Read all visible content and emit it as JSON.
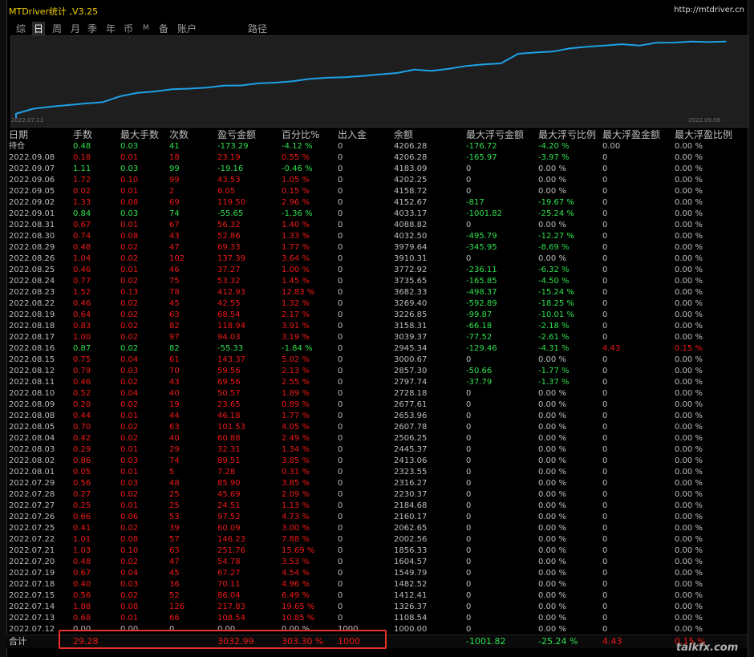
{
  "app": {
    "title": "MTDriver统计 ,V3.25",
    "url": "http://mtdriver.cn"
  },
  "tabs": [
    {
      "label": "综"
    },
    {
      "label": "日"
    },
    {
      "label": "周"
    },
    {
      "label": "月"
    },
    {
      "label": "季"
    },
    {
      "label": "年"
    },
    {
      "label": "币"
    },
    {
      "label": "M"
    },
    {
      "label": "备"
    },
    {
      "label": "账户"
    },
    {
      "label": "路径"
    }
  ],
  "chart": {
    "start_date": "2022.07.13",
    "end_date": "2022.09.08",
    "line_color": "#1ea1e6",
    "background": "#1e1e1e"
  },
  "chart_data": {
    "type": "line",
    "x": [
      "2022.07.13",
      "2022.07.14",
      "2022.07.15",
      "2022.07.18",
      "2022.07.19",
      "2022.07.20",
      "2022.07.21",
      "2022.07.22",
      "2022.07.25",
      "2022.07.26",
      "2022.07.27",
      "2022.07.28",
      "2022.07.29",
      "2022.08.01",
      "2022.08.02",
      "2022.08.03",
      "2022.08.04",
      "2022.08.05",
      "2022.08.08",
      "2022.08.09",
      "2022.08.10",
      "2022.08.11",
      "2022.08.12",
      "2022.08.15",
      "2022.08.16",
      "2022.08.17",
      "2022.08.18",
      "2022.08.19",
      "2022.08.22",
      "2022.08.23",
      "2022.08.24",
      "2022.08.25",
      "2022.08.26",
      "2022.08.29",
      "2022.08.30",
      "2022.08.31",
      "2022.09.01",
      "2022.09.02",
      "2022.09.05",
      "2022.09.06",
      "2022.09.07",
      "2022.09.08"
    ],
    "y": [
      1108.54,
      1326.37,
      1412.41,
      1482.52,
      1549.79,
      1604.57,
      1856.33,
      2002.56,
      2062.65,
      2160.17,
      2184.68,
      2230.37,
      2316.27,
      2323.55,
      2413.06,
      2445.37,
      2506.25,
      2607.78,
      2653.96,
      2677.61,
      2728.18,
      2797.74,
      2857.3,
      3000.67,
      2945.34,
      3039.37,
      3158.31,
      3226.85,
      3269.4,
      3682.33,
      3735.65,
      3772.92,
      3910.31,
      3979.64,
      4032.5,
      4088.82,
      4033.17,
      4152.67,
      4158.72,
      4202.25,
      4183.09,
      4206.28
    ],
    "ylim": [
      1000,
      4300
    ],
    "grid": false
  },
  "table": {
    "headers": [
      "日期",
      "手数",
      "最大手数",
      "次数",
      "盈亏金额",
      "百分比%",
      "出入金",
      "余额",
      "最大浮亏金额",
      "最大浮亏比例",
      "最大浮盈金额",
      "最大浮盈比例"
    ],
    "rows": [
      {
        "cells": [
          "持仓",
          "0.48",
          "0.03",
          "41",
          "-173.29",
          "-4.12 %",
          "0",
          "4206.28",
          "-176.72",
          "-4.20 %",
          "0.00",
          "0.00 %"
        ],
        "t": "pos",
        "v": "neg"
      },
      {
        "cells": [
          "2022.09.08",
          "0.18",
          "0.01",
          "18",
          "23.19",
          "0.55 %",
          "0",
          "4206.28",
          "-165.97",
          "-3.97 %",
          "0",
          "0.00 %"
        ],
        "t": "neg",
        "v": "neg"
      },
      {
        "cells": [
          "2022.09.07",
          "1.11",
          "0.03",
          "99",
          "-19.16",
          "-0.46 %",
          "0",
          "4183.09",
          "0",
          "0.00 %",
          "0",
          "0.00 %"
        ],
        "t": "pos",
        "v": "zero"
      },
      {
        "cells": [
          "2022.09.06",
          "1.72",
          "0.10",
          "99",
          "43.53",
          "1.05 %",
          "0",
          "4202.25",
          "0",
          "0.00 %",
          "0",
          "0.00 %"
        ],
        "t": "neg",
        "v": "zero"
      },
      {
        "cells": [
          "2022.09.05",
          "0.02",
          "0.01",
          "2",
          "6.05",
          "0.15 %",
          "0",
          "4158.72",
          "0",
          "0.00 %",
          "0",
          "0.00 %"
        ],
        "t": "neg",
        "v": "zero"
      },
      {
        "cells": [
          "2022.09.02",
          "1.33",
          "0.08",
          "69",
          "119.50",
          "2.96 %",
          "0",
          "4152.67",
          "-817",
          "-19.67 %",
          "0",
          "0.00 %"
        ],
        "t": "neg",
        "v": "neg"
      },
      {
        "cells": [
          "2022.09.01",
          "0.84",
          "0.03",
          "74",
          "-55.65",
          "-1.36 %",
          "0",
          "4033.17",
          "-1001.82",
          "-25.24 %",
          "0",
          "0.00 %"
        ],
        "t": "pos",
        "v": "neg"
      },
      {
        "cells": [
          "2022.08.31",
          "0.67",
          "0.01",
          "67",
          "56.32",
          "1.40 %",
          "0",
          "4088.82",
          "0",
          "0.00 %",
          "0",
          "0.00 %"
        ],
        "t": "neg",
        "v": "zero"
      },
      {
        "cells": [
          "2022.08.30",
          "0.74",
          "0.08",
          "43",
          "52.86",
          "1.33 %",
          "0",
          "4032.50",
          "-495.79",
          "-12.27 %",
          "0",
          "0.00 %"
        ],
        "t": "neg",
        "v": "neg"
      },
      {
        "cells": [
          "2022.08.29",
          "0.48",
          "0.02",
          "47",
          "69.33",
          "1.77 %",
          "0",
          "3979.64",
          "-345.95",
          "-8.69 %",
          "0",
          "0.00 %"
        ],
        "t": "neg",
        "v": "neg"
      },
      {
        "cells": [
          "2022.08.26",
          "1.04",
          "0.02",
          "102",
          "137.39",
          "3.64 %",
          "0",
          "3910.31",
          "0",
          "0.00 %",
          "0",
          "0.00 %"
        ],
        "t": "neg",
        "v": "zero"
      },
      {
        "cells": [
          "2022.08.25",
          "0.46",
          "0.01",
          "46",
          "37.27",
          "1.00 %",
          "0",
          "3772.92",
          "-236.11",
          "-6.32 %",
          "0",
          "0.00 %"
        ],
        "t": "neg",
        "v": "neg"
      },
      {
        "cells": [
          "2022.08.24",
          "0.77",
          "0.02",
          "75",
          "53.32",
          "1.45 %",
          "0",
          "3735.65",
          "-165.85",
          "-4.50 %",
          "0",
          "0.00 %"
        ],
        "t": "neg",
        "v": "neg"
      },
      {
        "cells": [
          "2022.08.23",
          "1.52",
          "0.13",
          "78",
          "412.93",
          "12.83 %",
          "0",
          "3682.33",
          "-498.37",
          "-15.24 %",
          "0",
          "0.00 %"
        ],
        "t": "neg",
        "v": "neg"
      },
      {
        "cells": [
          "2022.08.22",
          "0.46",
          "0.02",
          "45",
          "42.55",
          "1.32 %",
          "0",
          "3269.40",
          "-592.89",
          "-18.25 %",
          "0",
          "0.00 %"
        ],
        "t": "neg",
        "v": "neg"
      },
      {
        "cells": [
          "2022.08.19",
          "0.64",
          "0.02",
          "63",
          "68.54",
          "2.17 %",
          "0",
          "3226.85",
          "-99.87",
          "-10.01 %",
          "0",
          "0.00 %"
        ],
        "t": "neg",
        "v": "neg"
      },
      {
        "cells": [
          "2022.08.18",
          "0.83",
          "0.02",
          "82",
          "118.94",
          "3.91 %",
          "0",
          "3158.31",
          "-66.18",
          "-2.18 %",
          "0",
          "0.00 %"
        ],
        "t": "neg",
        "v": "neg"
      },
      {
        "cells": [
          "2022.08.17",
          "1.00",
          "0.02",
          "97",
          "94.03",
          "3.19 %",
          "0",
          "3039.37",
          "-77.52",
          "-2.61 %",
          "0",
          "0.00 %"
        ],
        "t": "neg",
        "v": "neg"
      },
      {
        "cells": [
          "2022.08.16",
          "0.87",
          "0.02",
          "82",
          "-55.33",
          "-1.84 %",
          "0",
          "2945.34",
          "-129.46",
          "-4.31 %",
          "4.43",
          "0.15 %"
        ],
        "t": "pos",
        "v": "both"
      },
      {
        "cells": [
          "2022.08.15",
          "0.75",
          "0.04",
          "61",
          "143.37",
          "5.02 %",
          "0",
          "3000.67",
          "0",
          "0.00 %",
          "0",
          "0.00 %"
        ],
        "t": "neg",
        "v": "zero"
      },
      {
        "cells": [
          "2022.08.12",
          "0.79",
          "0.03",
          "70",
          "59.56",
          "2.13 %",
          "0",
          "2857.30",
          "-50.66",
          "-1.77 %",
          "0",
          "0.00 %"
        ],
        "t": "neg",
        "v": "neg"
      },
      {
        "cells": [
          "2022.08.11",
          "0.46",
          "0.02",
          "43",
          "69.56",
          "2.55 %",
          "0",
          "2797.74",
          "-37.79",
          "-1.37 %",
          "0",
          "0.00 %"
        ],
        "t": "neg",
        "v": "neg"
      },
      {
        "cells": [
          "2022.08.10",
          "0.52",
          "0.04",
          "40",
          "50.57",
          "1.89 %",
          "0",
          "2728.18",
          "0",
          "0.00 %",
          "0",
          "0.00 %"
        ],
        "t": "neg",
        "v": "zero"
      },
      {
        "cells": [
          "2022.08.09",
          "0.20",
          "0.02",
          "19",
          "23.65",
          "0.89 %",
          "0",
          "2677.61",
          "0",
          "0.00 %",
          "0",
          "0.00 %"
        ],
        "t": "neg",
        "v": "zero"
      },
      {
        "cells": [
          "2022.08.08",
          "0.44",
          "0.01",
          "44",
          "46.18",
          "1.77 %",
          "0",
          "2653.96",
          "0",
          "0.00 %",
          "0",
          "0.00 %"
        ],
        "t": "neg",
        "v": "zero"
      },
      {
        "cells": [
          "2022.08.05",
          "0.70",
          "0.02",
          "63",
          "101.53",
          "4.05 %",
          "0",
          "2607.78",
          "0",
          "0.00 %",
          "0",
          "0.00 %"
        ],
        "t": "neg",
        "v": "zero"
      },
      {
        "cells": [
          "2022.08.04",
          "0.42",
          "0.02",
          "40",
          "60.88",
          "2.49 %",
          "0",
          "2506.25",
          "0",
          "0.00 %",
          "0",
          "0.00 %"
        ],
        "t": "neg",
        "v": "zero"
      },
      {
        "cells": [
          "2022.08.03",
          "0.29",
          "0.01",
          "29",
          "32.31",
          "1.34 %",
          "0",
          "2445.37",
          "0",
          "0.00 %",
          "0",
          "0.00 %"
        ],
        "t": "neg",
        "v": "zero"
      },
      {
        "cells": [
          "2022.08.02",
          "0.86",
          "0.03",
          "74",
          "89.51",
          "3.85 %",
          "0",
          "2413.06",
          "0",
          "0.00 %",
          "0",
          "0.00 %"
        ],
        "t": "neg",
        "v": "zero"
      },
      {
        "cells": [
          "2022.08.01",
          "0.05",
          "0.01",
          "5",
          "7.28",
          "0.31 %",
          "0",
          "2323.55",
          "0",
          "0.00 %",
          "0",
          "0.00 %"
        ],
        "t": "neg",
        "v": "zero"
      },
      {
        "cells": [
          "2022.07.29",
          "0.56",
          "0.03",
          "48",
          "85.90",
          "3.85 %",
          "0",
          "2316.27",
          "0",
          "0.00 %",
          "0",
          "0.00 %"
        ],
        "t": "neg",
        "v": "zero"
      },
      {
        "cells": [
          "2022.07.28",
          "0.27",
          "0.02",
          "25",
          "45.69",
          "2.09 %",
          "0",
          "2230.37",
          "0",
          "0.00 %",
          "0",
          "0.00 %"
        ],
        "t": "neg",
        "v": "zero"
      },
      {
        "cells": [
          "2022.07.27",
          "0.25",
          "0.01",
          "25",
          "24.51",
          "1.13 %",
          "0",
          "2184.68",
          "0",
          "0.00 %",
          "0",
          "0.00 %"
        ],
        "t": "neg",
        "v": "zero"
      },
      {
        "cells": [
          "2022.07.26",
          "0.66",
          "0.06",
          "53",
          "97.52",
          "4.73 %",
          "0",
          "2160.17",
          "0",
          "0.00 %",
          "0",
          "0.00 %"
        ],
        "t": "neg",
        "v": "zero"
      },
      {
        "cells": [
          "2022.07.25",
          "0.41",
          "0.02",
          "39",
          "60.09",
          "3.00 %",
          "0",
          "2062.65",
          "0",
          "0.00 %",
          "0",
          "0.00 %"
        ],
        "t": "neg",
        "v": "zero"
      },
      {
        "cells": [
          "2022.07.22",
          "1.01",
          "0.08",
          "57",
          "146.23",
          "7.88 %",
          "0",
          "2002.56",
          "0",
          "0.00 %",
          "0",
          "0.00 %"
        ],
        "t": "neg",
        "v": "zero"
      },
      {
        "cells": [
          "2022.07.21",
          "1.03",
          "0.10",
          "63",
          "251.76",
          "15.69 %",
          "0",
          "1856.33",
          "0",
          "0.00 %",
          "0",
          "0.00 %"
        ],
        "t": "neg",
        "v": "zero"
      },
      {
        "cells": [
          "2022.07.20",
          "0.48",
          "0.02",
          "47",
          "54.78",
          "3.53 %",
          "0",
          "1604.57",
          "0",
          "0.00 %",
          "0",
          "0.00 %"
        ],
        "t": "neg",
        "v": "zero"
      },
      {
        "cells": [
          "2022.07.19",
          "0.67",
          "0.04",
          "45",
          "67.27",
          "4.54 %",
          "0",
          "1549.79",
          "0",
          "0.00 %",
          "0",
          "0.00 %"
        ],
        "t": "neg",
        "v": "zero"
      },
      {
        "cells": [
          "2022.07.18",
          "0.40",
          "0.03",
          "36",
          "70.11",
          "4.96 %",
          "0",
          "1482.52",
          "0",
          "0.00 %",
          "0",
          "0.00 %"
        ],
        "t": "neg",
        "v": "zero"
      },
      {
        "cells": [
          "2022.07.15",
          "0.56",
          "0.02",
          "52",
          "86.04",
          "6.49 %",
          "0",
          "1412.41",
          "0",
          "0.00 %",
          "0",
          "0.00 %"
        ],
        "t": "neg",
        "v": "zero"
      },
      {
        "cells": [
          "2022.07.14",
          "1.88",
          "0.08",
          "126",
          "217.83",
          "19.65 %",
          "0",
          "1326.37",
          "0",
          "0.00 %",
          "0",
          "0.00 %"
        ],
        "t": "neg",
        "v": "zero"
      },
      {
        "cells": [
          "2022.07.13",
          "0.68",
          "0.01",
          "66",
          "108.54",
          "10.85 %",
          "0",
          "1108.54",
          "0",
          "0.00 %",
          "0",
          "0.00 %"
        ],
        "t": "neg",
        "v": "zero"
      },
      {
        "cells": [
          "2022.07.12",
          "0.00",
          "0.00",
          "0",
          "0.00",
          "0.00 %",
          "1000",
          "1000.00",
          "0",
          "0.00 %",
          "0",
          "0.00 %"
        ],
        "t": "zero",
        "v": "zero"
      }
    ],
    "total": [
      "合计",
      "29.28",
      "",
      "",
      "3032.99",
      "303.30 %",
      "1000",
      "",
      "-1001.82",
      "-25.24 %",
      "4.43",
      "0.15 %"
    ]
  },
  "colors": {
    "title": "#f2d000",
    "profit": "#f01818",
    "loss": "#2ee04e",
    "highlight_box": "#e8322a"
  },
  "watermark": "talkfx.com"
}
